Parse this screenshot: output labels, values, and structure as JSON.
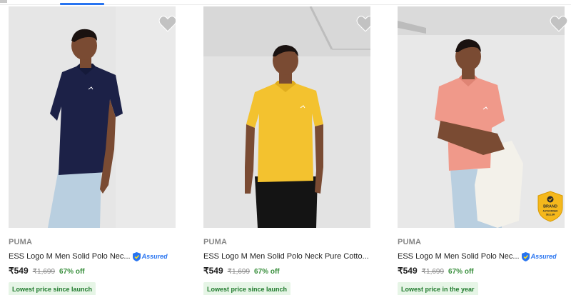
{
  "products": [
    {
      "brand": "PUMA",
      "title": "ESS Logo M Men Solid Polo Nec...",
      "assured": "Assured",
      "price": "₹549",
      "mrp": "₹1,699",
      "discount": "67% off",
      "tag": "Lowest price since launch",
      "shirt_color": "#1c2147"
    },
    {
      "brand": "PUMA",
      "title": "ESS Logo M Men Solid Polo Neck Pure Cotto...",
      "price": "₹549",
      "mrp": "₹1,699",
      "discount": "67% off",
      "tag": "Lowest price since launch",
      "shirt_color": "#f3c22f"
    },
    {
      "brand": "PUMA",
      "title": "ESS Logo M Men Solid Polo Nec...",
      "assured": "Assured",
      "price": "₹549",
      "mrp": "₹1,699",
      "discount": "67% off",
      "tag": "Lowest price in the year",
      "shirt_color": "#f0998a",
      "badge": {
        "line1": "BRAND",
        "line2": "AUTHORISED",
        "line3": "SELLER"
      }
    }
  ],
  "icons": {
    "wishlist": "heart-icon",
    "assured": "assured-shield-icon"
  },
  "colors": {
    "accent": "#2874f0",
    "discount": "#388e3c",
    "tag_bg": "#e6f5e6"
  }
}
